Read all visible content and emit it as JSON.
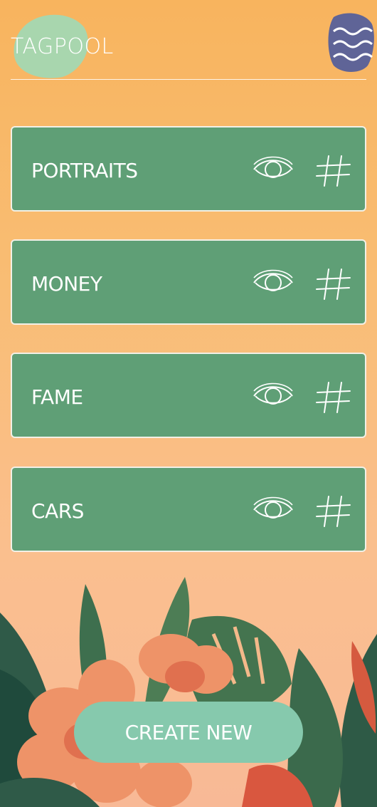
{
  "app": {
    "title": "TAGPOOL"
  },
  "header": {
    "menu_icon": "waves-menu-icon"
  },
  "tag_pools": [
    {
      "label": "PORTRAITS"
    },
    {
      "label": "MONEY"
    },
    {
      "label": "FAME"
    },
    {
      "label": "CARS"
    }
  ],
  "actions": {
    "create_label": "CREATE NEW"
  },
  "icons": {
    "view": "eye-icon",
    "hashtag": "hashtag-icon"
  },
  "colors": {
    "background_top": "#f8b45e",
    "card": "#5f9f76",
    "button": "#86c9ad",
    "logo_blob": "#a8d6ae",
    "menu_blob": "#5f6497"
  }
}
